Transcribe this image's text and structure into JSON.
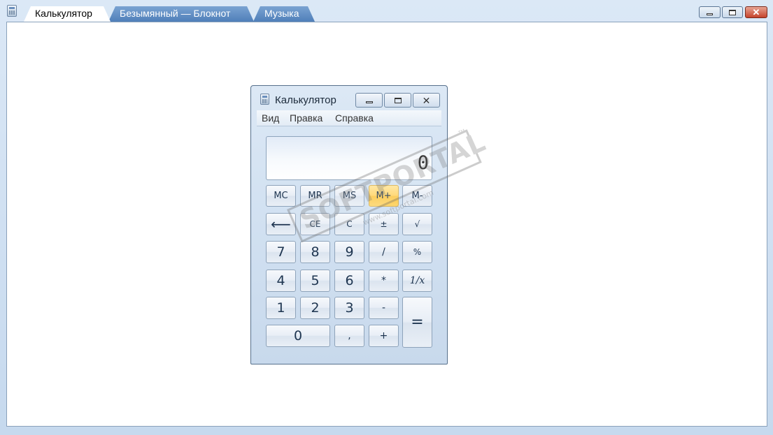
{
  "outer": {
    "tabs": [
      {
        "label": "Калькулятор",
        "active": true
      },
      {
        "label": "Безымянный — Блокнот",
        "active": false
      },
      {
        "label": "Музыка",
        "active": false
      }
    ],
    "close_glyph": "✕"
  },
  "calculator": {
    "title": "Калькулятор",
    "close_glyph": "✕",
    "menu": [
      "Вид",
      "Правка",
      "Справка"
    ],
    "display": "0",
    "memory_keys": [
      "MC",
      "MR",
      "MS",
      "M+",
      "M-"
    ],
    "edit_keys": [
      "⟵",
      "CE",
      "C",
      "±",
      "√"
    ],
    "keypad": {
      "k7": "7",
      "k8": "8",
      "k9": "9",
      "div": "/",
      "pct": "%",
      "k4": "4",
      "k5": "5",
      "k6": "6",
      "mul": "*",
      "recip": "1/x",
      "k1": "1",
      "k2": "2",
      "k3": "3",
      "sub": "-",
      "eq": "=",
      "k0": "0",
      "dec": ",",
      "add": "+"
    }
  },
  "watermark": {
    "brand": "SOFTPORTAL",
    "url": "www.softportal.com",
    "tm": "™"
  },
  "colors": {
    "highlight_key": "#ffd56b",
    "inactive_tab": "#5f8cc4",
    "close_button": "#c5432b"
  }
}
